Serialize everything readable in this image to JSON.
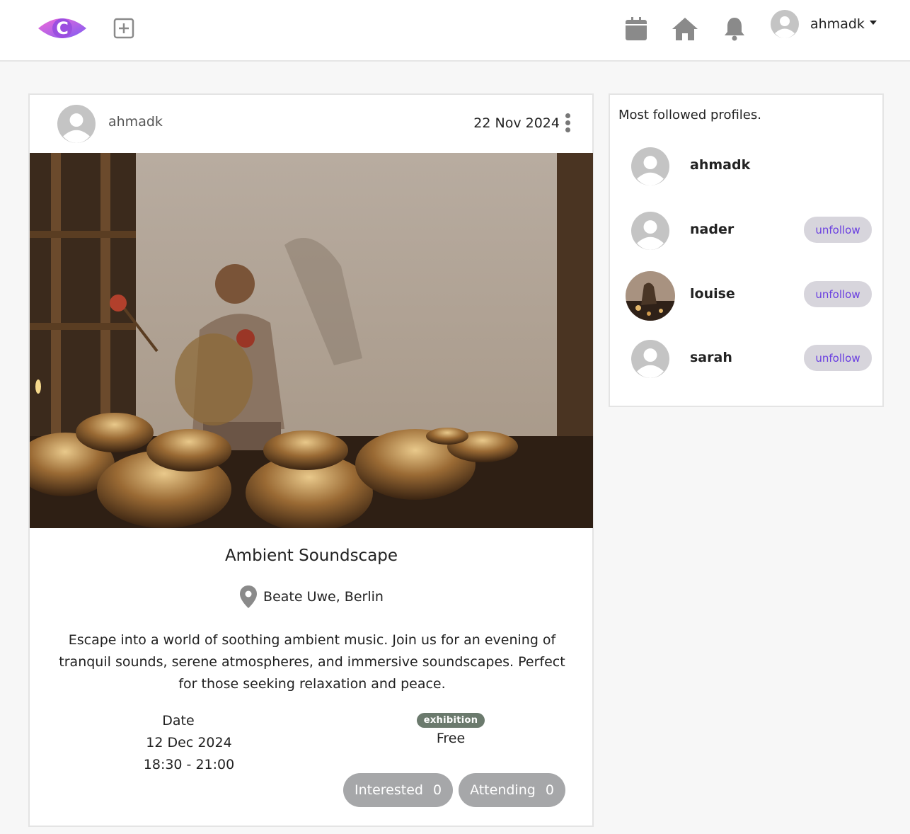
{
  "navbar": {
    "logo_letter": "C",
    "logo_icon": "eye-logo-icon",
    "add_icon": "plus-square-icon",
    "calendar_icon": "calendar-icon",
    "home_icon": "home-icon",
    "bell_icon": "bell-icon",
    "username": "ahmadk"
  },
  "post": {
    "author": "ahmadk",
    "date": "22 Nov 2024",
    "image_alt": "man playing singing bowls",
    "title": "Ambient Soundscape",
    "location": "Beate Uwe, Berlin",
    "description": "Escape into a world of soothing ambient music. Join us for an evening of tranquil sounds, serene atmospheres, and immersive soundscapes. Perfect for those seeking relaxation and peace.",
    "date_label": "Date",
    "event_date": "12 Dec 2024",
    "event_time": "18:30 - 21:00",
    "category": "exhibition",
    "price": "Free",
    "interested_label": "Interested",
    "interested_count": "0",
    "attending_label": "Attending",
    "attending_count": "0"
  },
  "sidebar": {
    "title": "Most followed profiles.",
    "profiles": [
      {
        "name": "ahmadk",
        "button": ""
      },
      {
        "name": "nader",
        "button": "unfollow"
      },
      {
        "name": "louise",
        "button": "unfollow"
      },
      {
        "name": "sarah",
        "button": "unfollow"
      }
    ]
  },
  "colors": {
    "accent": "#6a3fe0",
    "logo_gradient_start": "#e05ad6",
    "logo_gradient_end": "#8a5cf0",
    "icon_gray": "#8a8a8a",
    "badge": "#6b7a6d",
    "pill_button": "#a6a7a9"
  }
}
